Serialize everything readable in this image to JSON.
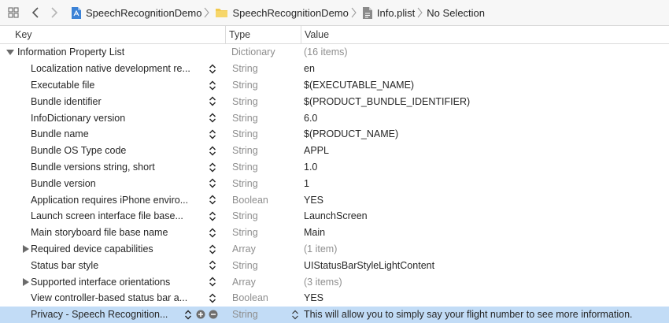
{
  "jumpbar": {
    "crumbs": [
      "SpeechRecognitionDemo",
      "SpeechRecognitionDemo",
      "Info.plist",
      "No Selection"
    ],
    "icons": [
      "grid-icon",
      "back-arrow-icon",
      "forward-arrow-icon",
      "project-file-icon",
      "folder-icon",
      "plist-file-icon"
    ]
  },
  "table": {
    "headers": {
      "key": "Key",
      "type": "Type",
      "value": "Value"
    },
    "root": {
      "key": "Information Property List",
      "type": "Dictionary",
      "value": "(16 items)"
    },
    "rows": [
      {
        "key": "Localization native development re...",
        "type": "String",
        "value": "en"
      },
      {
        "key": "Executable file",
        "type": "String",
        "value": "$(EXECUTABLE_NAME)"
      },
      {
        "key": "Bundle identifier",
        "type": "String",
        "value": "$(PRODUCT_BUNDLE_IDENTIFIER)"
      },
      {
        "key": "InfoDictionary version",
        "type": "String",
        "value": "6.0"
      },
      {
        "key": "Bundle name",
        "type": "String",
        "value": "$(PRODUCT_NAME)"
      },
      {
        "key": "Bundle OS Type code",
        "type": "String",
        "value": "APPL"
      },
      {
        "key": "Bundle versions string, short",
        "type": "String",
        "value": "1.0"
      },
      {
        "key": "Bundle version",
        "type": "String",
        "value": "1"
      },
      {
        "key": "Application requires iPhone enviro...",
        "type": "Boolean",
        "value": "YES"
      },
      {
        "key": "Launch screen interface file base...",
        "type": "String",
        "value": "LaunchScreen"
      },
      {
        "key": "Main storyboard file base name",
        "type": "String",
        "value": "Main"
      },
      {
        "key": "Required device capabilities",
        "type": "Array",
        "value": "(1 item)"
      },
      {
        "key": "Status bar style",
        "type": "String",
        "value": "UIStatusBarStyleLightContent"
      },
      {
        "key": "Supported interface orientations",
        "type": "Array",
        "value": "(3 items)"
      },
      {
        "key": "View controller-based status bar a...",
        "type": "Boolean",
        "value": "YES"
      },
      {
        "key": "Privacy - Speech Recognition...",
        "type": "String",
        "value": "This will allow you to simply say your flight number to see more information."
      }
    ]
  },
  "colors": {
    "selection": "#c2dcf6",
    "muted_text": "#8e8e8e",
    "folder": "#f2c94c",
    "project_icon": "#3b82d6"
  }
}
